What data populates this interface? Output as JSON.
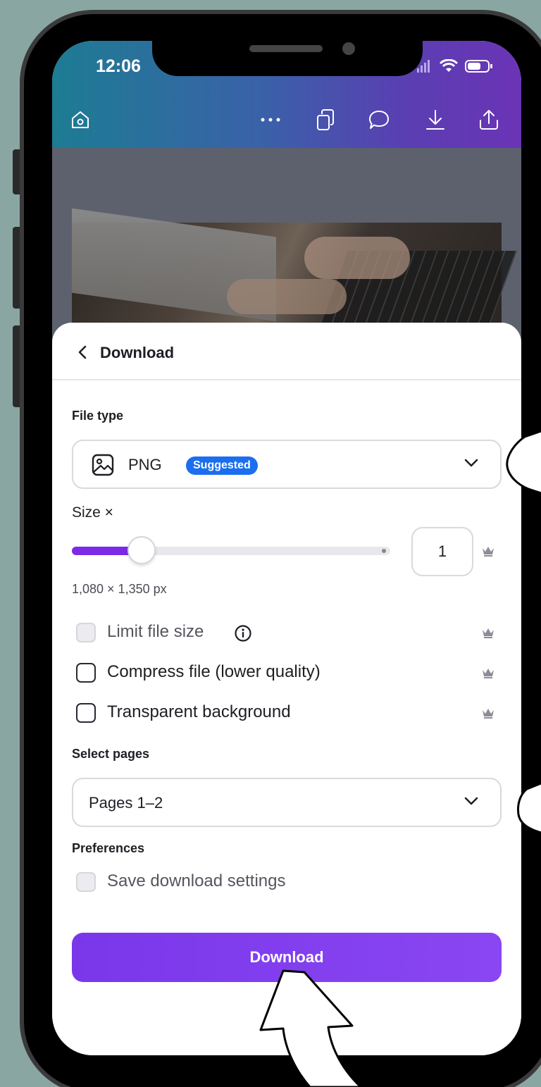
{
  "status_bar": {
    "time": "12:06"
  },
  "toolbar": {
    "icons": [
      "home-icon",
      "more-icon",
      "pages-icon",
      "comment-icon",
      "download-icon",
      "share-icon"
    ]
  },
  "sheet": {
    "title": "Download",
    "file_type": {
      "label": "File type",
      "value": "PNG",
      "badge": "Suggested"
    },
    "size": {
      "label": "Size ×",
      "value": "1",
      "slider_fraction": 0.22,
      "dimensions": "1,080 × 1,350 px"
    },
    "options": [
      {
        "label": "Limit file size",
        "checked": false,
        "disabled": true,
        "pro": true
      },
      {
        "label": "Compress file (lower quality)",
        "checked": false,
        "disabled": false,
        "pro": true
      },
      {
        "label": "Transparent background",
        "checked": false,
        "disabled": false,
        "pro": true
      }
    ],
    "select_pages": {
      "label": "Select pages",
      "value": "Pages 1–2"
    },
    "preferences": {
      "label": "Preferences",
      "save_label": "Save download settings",
      "checked": false
    },
    "download_button": "Download"
  },
  "colors": {
    "accent": "#7d2ae8",
    "badge": "#1b6ef0",
    "background": "#8aa6a2"
  }
}
